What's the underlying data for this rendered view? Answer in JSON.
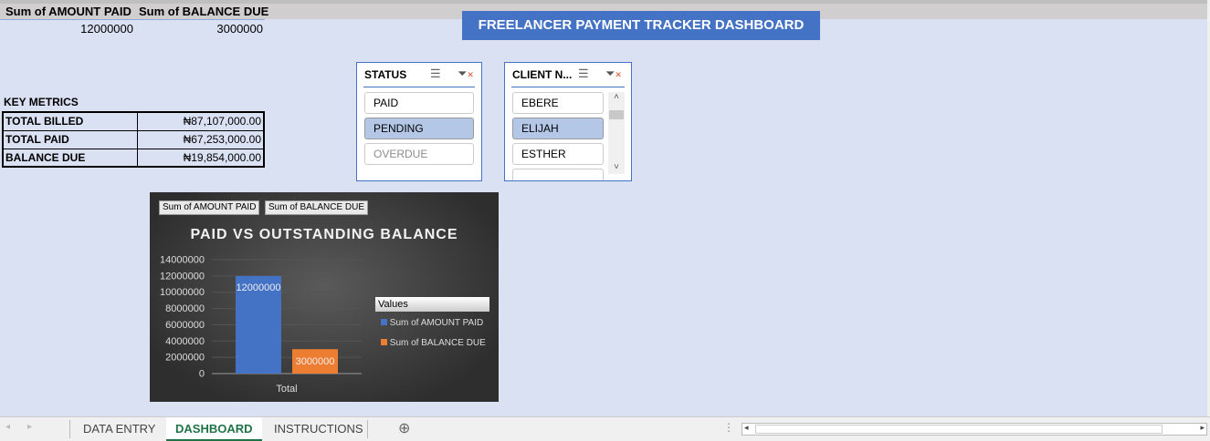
{
  "pivot": {
    "headers": [
      "Sum of AMOUNT PAID",
      "Sum of BALANCE DUE"
    ],
    "values": [
      "12000000",
      "3000000"
    ]
  },
  "dashboard_title": "FREELANCER PAYMENT TRACKER DASHBOARD",
  "key_metrics": {
    "title": "KEY METRICS",
    "rows": [
      {
        "label": "TOTAL BILLED",
        "value": "₦87,107,000.00"
      },
      {
        "label": "TOTAL PAID",
        "value": "₦67,253,000.00"
      },
      {
        "label": "BALANCE DUE",
        "value": "₦19,854,000.00"
      }
    ]
  },
  "status_slicer": {
    "title": "STATUS",
    "items": [
      "PAID",
      "PENDING",
      "OVERDUE"
    ],
    "selected": "PENDING"
  },
  "client_slicer": {
    "title": "CLIENT N...",
    "items": [
      "EBERE",
      "ELIJAH",
      "ESTHER"
    ],
    "selected": "ELIJAH"
  },
  "chart_data": {
    "type": "bar",
    "title": "PAID VS OUTSTANDING BALANCE",
    "field_buttons": [
      "Sum of AMOUNT PAID",
      "Sum of BALANCE DUE"
    ],
    "categories": [
      "Total"
    ],
    "series": [
      {
        "name": "Sum of AMOUNT PAID",
        "values": [
          12000000
        ],
        "color": "#4472c4"
      },
      {
        "name": "Sum of BALANCE DUE",
        "values": [
          3000000
        ],
        "color": "#ed7d31"
      }
    ],
    "yticks": [
      "0",
      "2000000",
      "4000000",
      "6000000",
      "8000000",
      "10000000",
      "12000000",
      "14000000"
    ],
    "ylim": [
      0,
      14000000
    ],
    "legend_title": "Values",
    "legend_position": "right",
    "data_labels": [
      "12000000",
      "3000000"
    ]
  },
  "sheet_tabs": [
    "DATA ENTRY",
    "DASHBOARD",
    "INSTRUCTIONS"
  ],
  "active_tab": "DASHBOARD"
}
